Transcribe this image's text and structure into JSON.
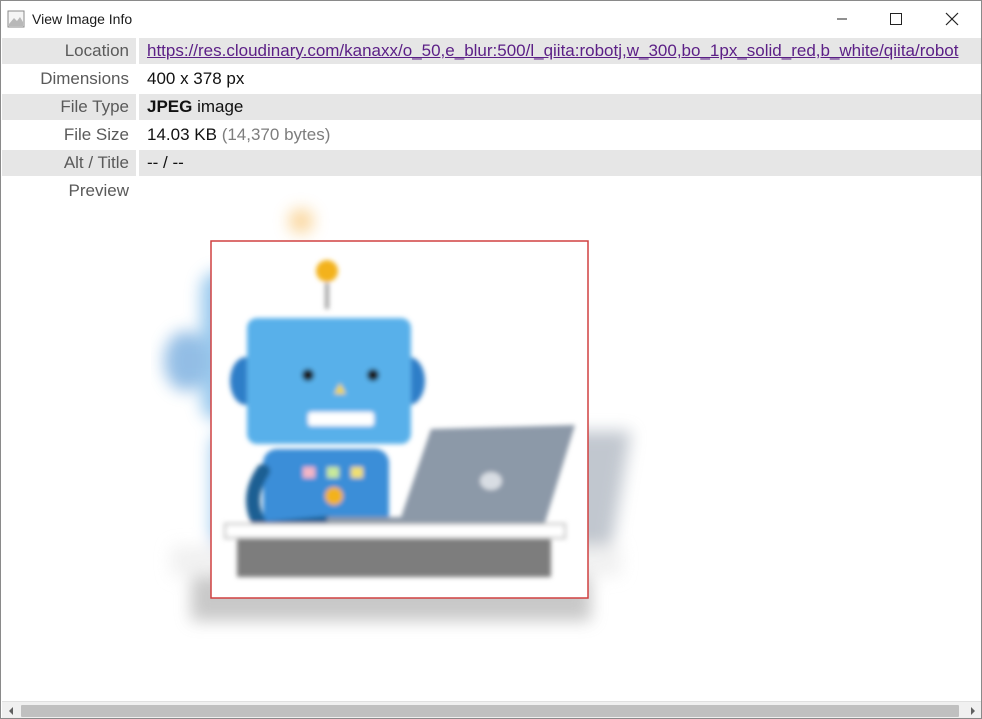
{
  "window": {
    "title": "View Image Info",
    "icon": "image-icon"
  },
  "controls": {
    "minimize_icon": "minimize-icon",
    "maximize_icon": "maximize-icon",
    "close_icon": "close-icon"
  },
  "info": {
    "location_label": "Location",
    "location_value": "https://res.cloudinary.com/kanaxx/o_50,e_blur:500/l_qiita:robotj,w_300,bo_1px_solid_red,b_white/qiita/robot",
    "dimensions_label": "Dimensions",
    "dimensions_value": "400 x 378 px",
    "filetype_label": "File Type",
    "filetype_format": "JPEG",
    "filetype_suffix": " image",
    "filesize_label": "File Size",
    "filesize_value": "14.03 KB",
    "filesize_bytes": "(14,370 bytes)",
    "alt_label": "Alt / Title",
    "alt_value": "-- / --",
    "preview_label": "Preview"
  },
  "colors": {
    "link": "#5b1f86",
    "row_alt": "#e6e6e6",
    "border_red": "#d04040"
  }
}
